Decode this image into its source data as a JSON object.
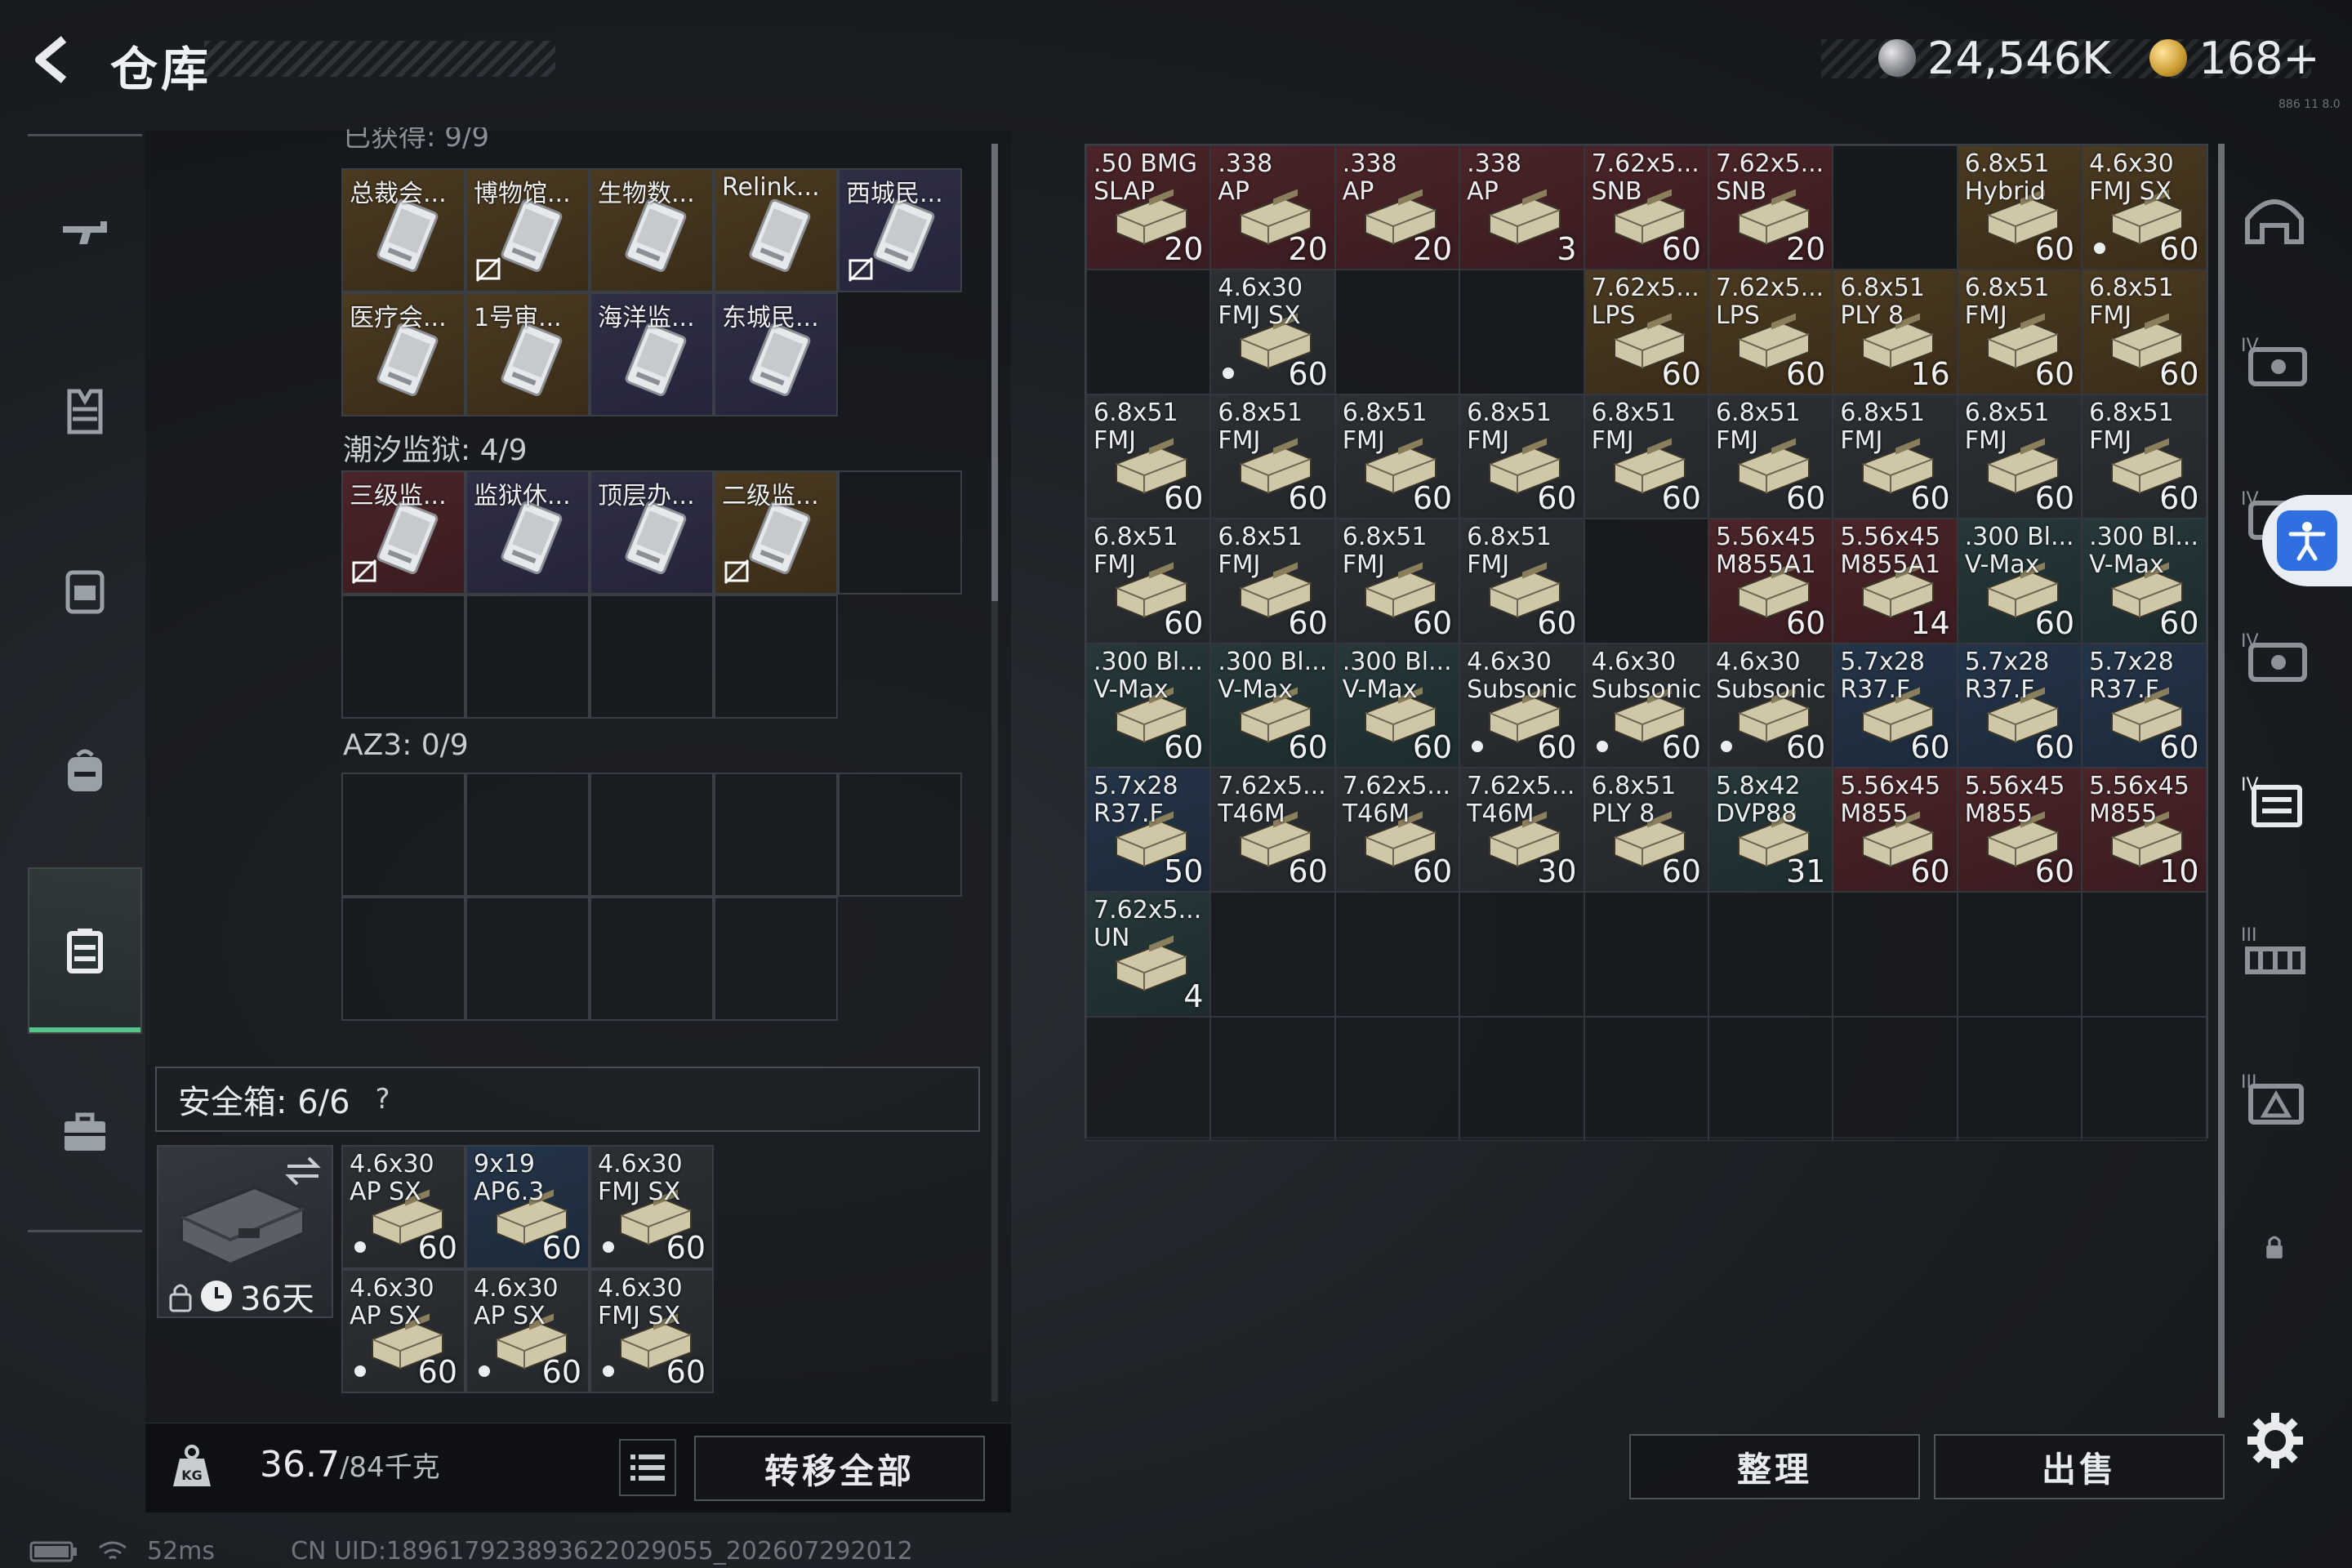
{
  "header": {
    "title": "仓库",
    "silver": "24,546K",
    "gold": "168+",
    "tiny_note": "886 11 8.0"
  },
  "left_nav": {
    "items": [
      {
        "name": "weapon-icon",
        "active": false
      },
      {
        "name": "armor-icon",
        "active": false
      },
      {
        "name": "chest-rig-icon",
        "active": false
      },
      {
        "name": "backpack-icon",
        "active": false
      },
      {
        "name": "key-case-icon",
        "active": true
      },
      {
        "name": "briefcase-icon",
        "active": false
      }
    ]
  },
  "key_panel": {
    "truncated_header": "已获得: 9/9",
    "group1": [
      {
        "label": "总裁会...",
        "tier": "gold",
        "no_sell": false
      },
      {
        "label": "博物馆...",
        "tier": "gold",
        "no_sell": true
      },
      {
        "label": "生物数...",
        "tier": "gold",
        "no_sell": false
      },
      {
        "label": "Relink...",
        "tier": "gold",
        "no_sell": false
      },
      {
        "label": "西城民...",
        "tier": "purple",
        "no_sell": true
      },
      {
        "label": "医疗会...",
        "tier": "gold",
        "no_sell": false
      },
      {
        "label": "1号审...",
        "tier": "gold",
        "no_sell": false
      },
      {
        "label": "海洋监...",
        "tier": "purple",
        "no_sell": false
      },
      {
        "label": "东城民...",
        "tier": "purple",
        "no_sell": false
      }
    ],
    "section2_label": "潮汐监狱: 4/9",
    "group2": [
      {
        "label": "三级监...",
        "tier": "red",
        "no_sell": true
      },
      {
        "label": "监狱休...",
        "tier": "purple",
        "no_sell": false
      },
      {
        "label": "顶层办...",
        "tier": "purple",
        "no_sell": false
      },
      {
        "label": "二级监...",
        "tier": "gold",
        "no_sell": true
      }
    ],
    "section3_label": "AZ3: 0/9"
  },
  "safe_box": {
    "label": "安全箱: 6/6",
    "help": "?",
    "timer": "36天",
    "items": [
      {
        "label": "4.6x30",
        "sub": "AP SX",
        "count": "60",
        "tier": "gray",
        "dot": true
      },
      {
        "label": "9x19",
        "sub": "AP6.3",
        "count": "60",
        "tier": "blue",
        "dot": false
      },
      {
        "label": "4.6x30",
        "sub": "FMJ SX",
        "count": "60",
        "tier": "gray",
        "dot": true
      },
      {
        "label": "4.6x30",
        "sub": "AP SX",
        "count": "60",
        "tier": "gray",
        "dot": true
      },
      {
        "label": "4.6x30",
        "sub": "AP SX",
        "count": "60",
        "tier": "gray",
        "dot": true
      },
      {
        "label": "4.6x30",
        "sub": "FMJ SX",
        "count": "60",
        "tier": "gray",
        "dot": true
      }
    ]
  },
  "bottom_left": {
    "weight": "36.7",
    "weight_cap": "/84千克",
    "transfer_label": "转移全部"
  },
  "right_actions": {
    "sort_label": "整理",
    "sell_label": "出售"
  },
  "inventory": [
    {
      "label": ".50 BMG",
      "sub": "SLAP",
      "count": "20",
      "tier": "red",
      "dot": false
    },
    {
      "label": ".338",
      "sub": "AP",
      "count": "20",
      "tier": "red",
      "dot": false
    },
    {
      "label": ".338",
      "sub": "AP",
      "count": "20",
      "tier": "red",
      "dot": false
    },
    {
      "label": ".338",
      "sub": "AP",
      "count": "3",
      "tier": "red",
      "dot": false
    },
    {
      "label": "7.62x5...",
      "sub": "SNB",
      "count": "60",
      "tier": "red",
      "dot": false
    },
    {
      "label": "7.62x5...",
      "sub": "SNB",
      "count": "20",
      "tier": "red",
      "dot": false
    },
    null,
    {
      "label": "6.8x51",
      "sub": "Hybrid",
      "count": "60",
      "tier": "gold",
      "dot": false
    },
    {
      "label": "4.6x30",
      "sub": "FMJ SX",
      "count": "60",
      "tier": "gold",
      "dot": true
    },
    null,
    {
      "label": "4.6x30",
      "sub": "FMJ SX",
      "count": "60",
      "tier": "gray",
      "dot": true
    },
    null,
    null,
    {
      "label": "7.62x5...",
      "sub": "LPS",
      "count": "60",
      "tier": "gold",
      "dot": false
    },
    {
      "label": "7.62x5...",
      "sub": "LPS",
      "count": "60",
      "tier": "gold",
      "dot": false
    },
    {
      "label": "6.8x51",
      "sub": "PLY 8",
      "count": "16",
      "tier": "gold",
      "dot": false
    },
    {
      "label": "6.8x51",
      "sub": "FMJ",
      "count": "60",
      "tier": "gold",
      "dot": false
    },
    {
      "label": "6.8x51",
      "sub": "FMJ",
      "count": "60",
      "tier": "gold",
      "dot": false
    },
    {
      "label": "6.8x51",
      "sub": "FMJ",
      "count": "60",
      "tier": "gray",
      "dot": false
    },
    {
      "label": "6.8x51",
      "sub": "FMJ",
      "count": "60",
      "tier": "gray",
      "dot": false
    },
    {
      "label": "6.8x51",
      "sub": "FMJ",
      "count": "60",
      "tier": "gray",
      "dot": false
    },
    {
      "label": "6.8x51",
      "sub": "FMJ",
      "count": "60",
      "tier": "gray",
      "dot": false
    },
    {
      "label": "6.8x51",
      "sub": "FMJ",
      "count": "60",
      "tier": "gray",
      "dot": false
    },
    {
      "label": "6.8x51",
      "sub": "FMJ",
      "count": "60",
      "tier": "gray",
      "dot": false
    },
    {
      "label": "6.8x51",
      "sub": "FMJ",
      "count": "60",
      "tier": "gray",
      "dot": false
    },
    {
      "label": "6.8x51",
      "sub": "FMJ",
      "count": "60",
      "tier": "gray",
      "dot": false
    },
    {
      "label": "6.8x51",
      "sub": "FMJ",
      "count": "60",
      "tier": "gray",
      "dot": false
    },
    {
      "label": "6.8x51",
      "sub": "FMJ",
      "count": "60",
      "tier": "gray",
      "dot": false
    },
    {
      "label": "6.8x51",
      "sub": "FMJ",
      "count": "60",
      "tier": "gray",
      "dot": false
    },
    {
      "label": "6.8x51",
      "sub": "FMJ",
      "count": "60",
      "tier": "gray",
      "dot": false
    },
    {
      "label": "6.8x51",
      "sub": "FMJ",
      "count": "60",
      "tier": "gray",
      "dot": false
    },
    null,
    {
      "label": "5.56x45",
      "sub": "M855A1",
      "count": "60",
      "tier": "red",
      "dot": false
    },
    {
      "label": "5.56x45",
      "sub": "M855A1",
      "count": "14",
      "tier": "red",
      "dot": false
    },
    {
      "label": ".300 Bl...",
      "sub": "V-Max",
      "count": "60",
      "tier": "green",
      "dot": false
    },
    {
      "label": ".300 Bl...",
      "sub": "V-Max",
      "count": "60",
      "tier": "green",
      "dot": false
    },
    {
      "label": ".300 Bl...",
      "sub": "V-Max",
      "count": "60",
      "tier": "green",
      "dot": false
    },
    {
      "label": ".300 Bl...",
      "sub": "V-Max",
      "count": "60",
      "tier": "green",
      "dot": false
    },
    {
      "label": ".300 Bl...",
      "sub": "V-Max",
      "count": "60",
      "tier": "green",
      "dot": false
    },
    {
      "label": "4.6x30",
      "sub": "Subsonic",
      "count": "60",
      "tier": "gray",
      "dot": true
    },
    {
      "label": "4.6x30",
      "sub": "Subsonic",
      "count": "60",
      "tier": "gray",
      "dot": true
    },
    {
      "label": "4.6x30",
      "sub": "Subsonic",
      "count": "60",
      "tier": "gray",
      "dot": true
    },
    {
      "label": "5.7x28",
      "sub": "R37.F",
      "count": "60",
      "tier": "blue",
      "dot": false
    },
    {
      "label": "5.7x28",
      "sub": "R37.F",
      "count": "60",
      "tier": "blue",
      "dot": false
    },
    {
      "label": "5.7x28",
      "sub": "R37.F",
      "count": "60",
      "tier": "blue",
      "dot": false
    },
    {
      "label": "5.7x28",
      "sub": "R37.F",
      "count": "50",
      "tier": "blue",
      "dot": false
    },
    {
      "label": "7.62x5...",
      "sub": "T46M",
      "count": "60",
      "tier": "gray",
      "dot": false
    },
    {
      "label": "7.62x5...",
      "sub": "T46M",
      "count": "60",
      "tier": "gray",
      "dot": false
    },
    {
      "label": "7.62x5...",
      "sub": "T46M",
      "count": "30",
      "tier": "gray",
      "dot": false
    },
    {
      "label": "6.8x51",
      "sub": "PLY 8",
      "count": "60",
      "tier": "gray",
      "dot": false
    },
    {
      "label": "5.8x42",
      "sub": "DVP88",
      "count": "31",
      "tier": "green",
      "dot": false
    },
    {
      "label": "5.56x45",
      "sub": "M855",
      "count": "60",
      "tier": "red",
      "dot": false
    },
    {
      "label": "5.56x45",
      "sub": "M855",
      "count": "60",
      "tier": "red",
      "dot": false
    },
    {
      "label": "5.56x45",
      "sub": "M855",
      "count": "10",
      "tier": "red",
      "dot": false
    },
    {
      "label": "7.62x5...",
      "sub": "UN",
      "count": "4",
      "tier": "green",
      "dot": false
    }
  ],
  "right_rail": [
    "armored-helmet-icon",
    "tier4-vest-icon",
    "tier4-rig-icon",
    "tier4-plate-icon",
    "tier4-case-icon",
    "tier3-rig-icon",
    "tier3-plate-icon",
    "lock-icon"
  ],
  "status": {
    "ping": "52ms",
    "uid": "CN UID:1896179238936220290​55_202607292012"
  },
  "colors": {
    "accent": "#58c48d",
    "red": "#4a2428",
    "gold": "#4a3a22",
    "purple": "#2f2e44",
    "blue": "#243548",
    "green": "#26383a"
  }
}
